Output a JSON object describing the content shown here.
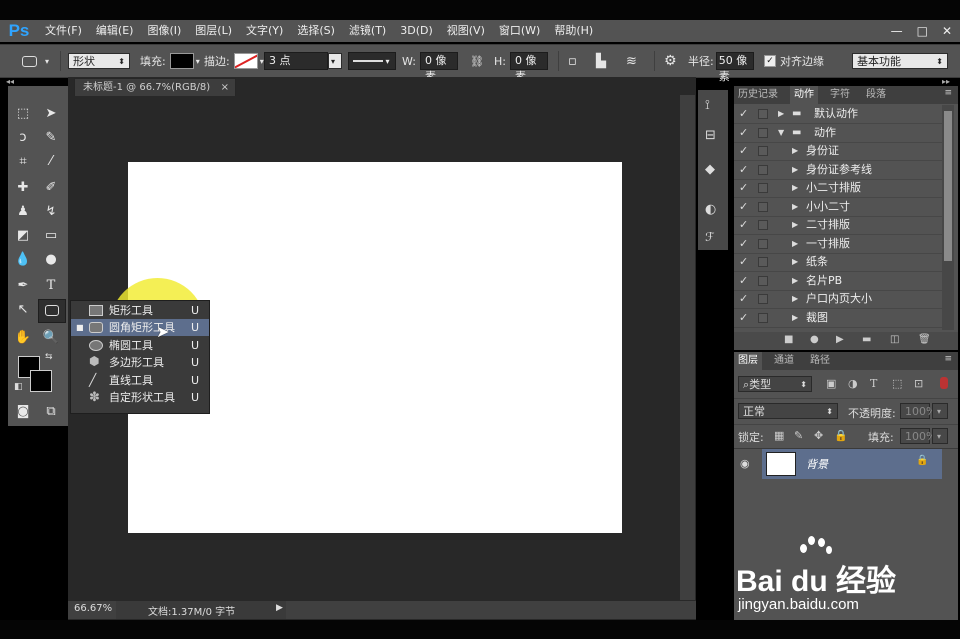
{
  "app": {
    "logo": "Ps"
  },
  "menu": [
    "文件(F)",
    "编辑(E)",
    "图像(I)",
    "图层(L)",
    "文字(Y)",
    "选择(S)",
    "滤镜(T)",
    "3D(D)",
    "视图(V)",
    "窗口(W)",
    "帮助(H)"
  ],
  "window_controls": {
    "minimize": "—",
    "maximize": "□",
    "close": "✕"
  },
  "options_bar": {
    "mode": "形状",
    "fill_label": "填充:",
    "stroke_label": "描边:",
    "stroke_size": "3 点",
    "w_label": "W:",
    "w_value": "0 像素",
    "h_label": "H:",
    "h_value": "0 像素",
    "radius_label": "半径:",
    "radius_value": "50 像素",
    "align_edges_label": "对齐边缘",
    "workspace": "基本功能"
  },
  "document": {
    "tab_title": "未标题-1 @ 66.7%(RGB/8)",
    "zoom": "66.67%",
    "doc_info": "文档:1.37M/0 字节"
  },
  "flyout": {
    "items": [
      {
        "label": "矩形工具",
        "key": "U",
        "icon": "rectangle-icon",
        "selected": false
      },
      {
        "label": "圆角矩形工具",
        "key": "U",
        "icon": "rounded-rectangle-icon",
        "selected": true
      },
      {
        "label": "椭圆工具",
        "key": "U",
        "icon": "ellipse-icon",
        "selected": false
      },
      {
        "label": "多边形工具",
        "key": "U",
        "icon": "polygon-icon",
        "selected": false
      },
      {
        "label": "直线工具",
        "key": "U",
        "icon": "line-icon",
        "selected": false
      },
      {
        "label": "自定形状工具",
        "key": "U",
        "icon": "custom-shape-icon",
        "selected": false
      }
    ]
  },
  "actions_panel": {
    "tabs": [
      "历史记录",
      "动作",
      "字符",
      "段落"
    ],
    "active_tab": "动作",
    "rows": [
      {
        "label": "默认动作",
        "type": "set"
      },
      {
        "label": "动作",
        "type": "set-open"
      },
      {
        "label": "身份证",
        "type": "action"
      },
      {
        "label": "身份证参考线",
        "type": "action"
      },
      {
        "label": "小二寸排版",
        "type": "action"
      },
      {
        "label": "小小二寸",
        "type": "action"
      },
      {
        "label": "二寸排版",
        "type": "action"
      },
      {
        "label": "一寸排版",
        "type": "action"
      },
      {
        "label": "纸条",
        "type": "action"
      },
      {
        "label": "名片PB",
        "type": "action"
      },
      {
        "label": "户口内页大小",
        "type": "action"
      },
      {
        "label": "裁图",
        "type": "action"
      }
    ]
  },
  "layers_panel": {
    "tabs": [
      "图层",
      "通道",
      "路径"
    ],
    "active_tab": "图层",
    "filter": "类型",
    "blend_mode": "正常",
    "opacity_label": "不透明度:",
    "opacity_value": "100%",
    "lock_label": "锁定:",
    "fill_label": "填充:",
    "fill_value": "100%",
    "layer_name": "背景"
  },
  "watermark": {
    "brand": "Bai du 经验",
    "url": "jingyan.baidu.com"
  },
  "colors": {
    "accent": "#2fa4ff",
    "highlight": "#f1ec2f",
    "selection": "#5d6e8d"
  }
}
